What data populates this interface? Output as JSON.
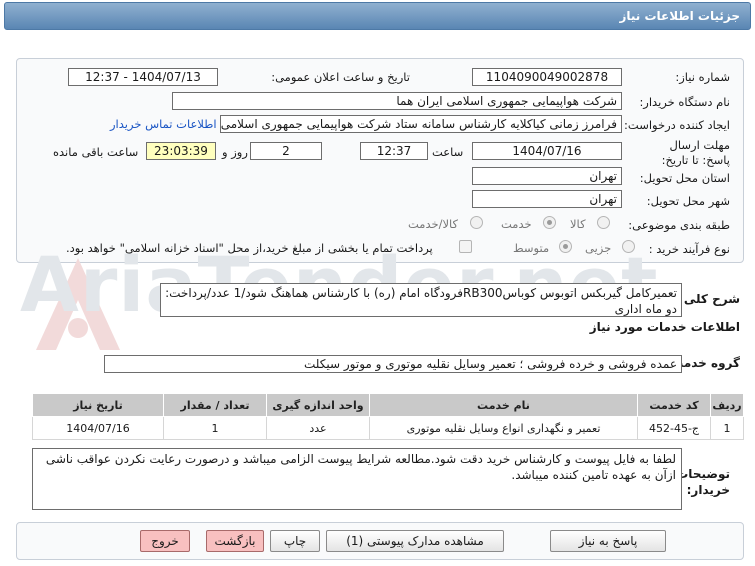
{
  "header": {
    "title": "جزئیات اطلاعات نیاز"
  },
  "need": {
    "number_label": "شماره نیاز:",
    "number": "1104090049002878",
    "announce_label": "تاریخ و ساعت اعلان عمومی:",
    "announce_value": "1404/07/13 - 12:37",
    "buyer_label": "نام دستگاه خریدار:",
    "buyer": "شرکت هواپیمایی جمهوری اسلامی ایران هما",
    "creator_label": "ایجاد کننده درخواست:",
    "creator": "فرامرز زمانی کیاکلایه کارشناس سامانه ستاد شرکت هواپیمایی جمهوری اسلامی ایران هما",
    "contact_link": "اطلاعات تماس خریدار",
    "deadline_label": "مهلت ارسال پاسخ: تا تاریخ:",
    "deadline_date": "1404/07/16",
    "time_label": "ساعت",
    "deadline_time": "12:37",
    "days": "2",
    "days_label": "روز و",
    "remaining": "23:03:39",
    "remaining_label": "ساعت باقی مانده",
    "province_label": "استان محل تحویل:",
    "province": "تهران",
    "city_label": "شهر محل تحویل:",
    "city": "تهران",
    "category_label": "طبقه بندی موضوعی:",
    "category_options": [
      "کالا",
      "خدمت",
      "کالا/خدمت"
    ],
    "process_label": "نوع فرآیند خرید :",
    "process_options": [
      "جزیی",
      "متوسط"
    ],
    "payment_note": "پرداخت تمام یا بخشی از مبلغ خرید،از محل \"اسناد خزانه اسلامی\" خواهد بود."
  },
  "description": {
    "label": "شرح کلی نیاز:",
    "text": "تعمیرکامل گیربکس اتوبوس کوباسRB300فرودگاه امام (ره) با کارشناس هماهنگ شود/1 عدد/پرداخت: دو ماه اداری"
  },
  "services": {
    "title": "اطلاعات خدمات مورد نیاز",
    "group_label": "گروه خدمت:",
    "group_value": "عمده فروشی و خرده فروشی ؛ تعمیر وسایل نقلیه موتوری و موتور سیکلت",
    "columns": [
      "ردیف",
      "کد خدمت",
      "نام خدمت",
      "واحد اندازه گیری",
      "تعداد / مقدار",
      "تاریخ نیاز"
    ],
    "rows": [
      [
        "1",
        "ج-45-452",
        "تعمیر و نگهداری انواع وسایل نقلیه موتوری",
        "عدد",
        "1",
        "1404/07/16"
      ]
    ]
  },
  "notes": {
    "label": "توضیحات خریدار:",
    "text": "لطفا به فایل پیوست و کارشناس خرید دقت شود.مطالعه شرایط پیوست الزامی میباشد و درصورت رعایت نکردن عواقب ناشی ازآن به عهده تامین کننده میباشد."
  },
  "buttons": {
    "reply": "پاسخ به نیاز",
    "attachments": "مشاهده مدارک پیوستی (1)",
    "print": "چاپ",
    "back": "بازگشت",
    "exit": "خروج"
  },
  "watermark": "AriaTender.net"
}
